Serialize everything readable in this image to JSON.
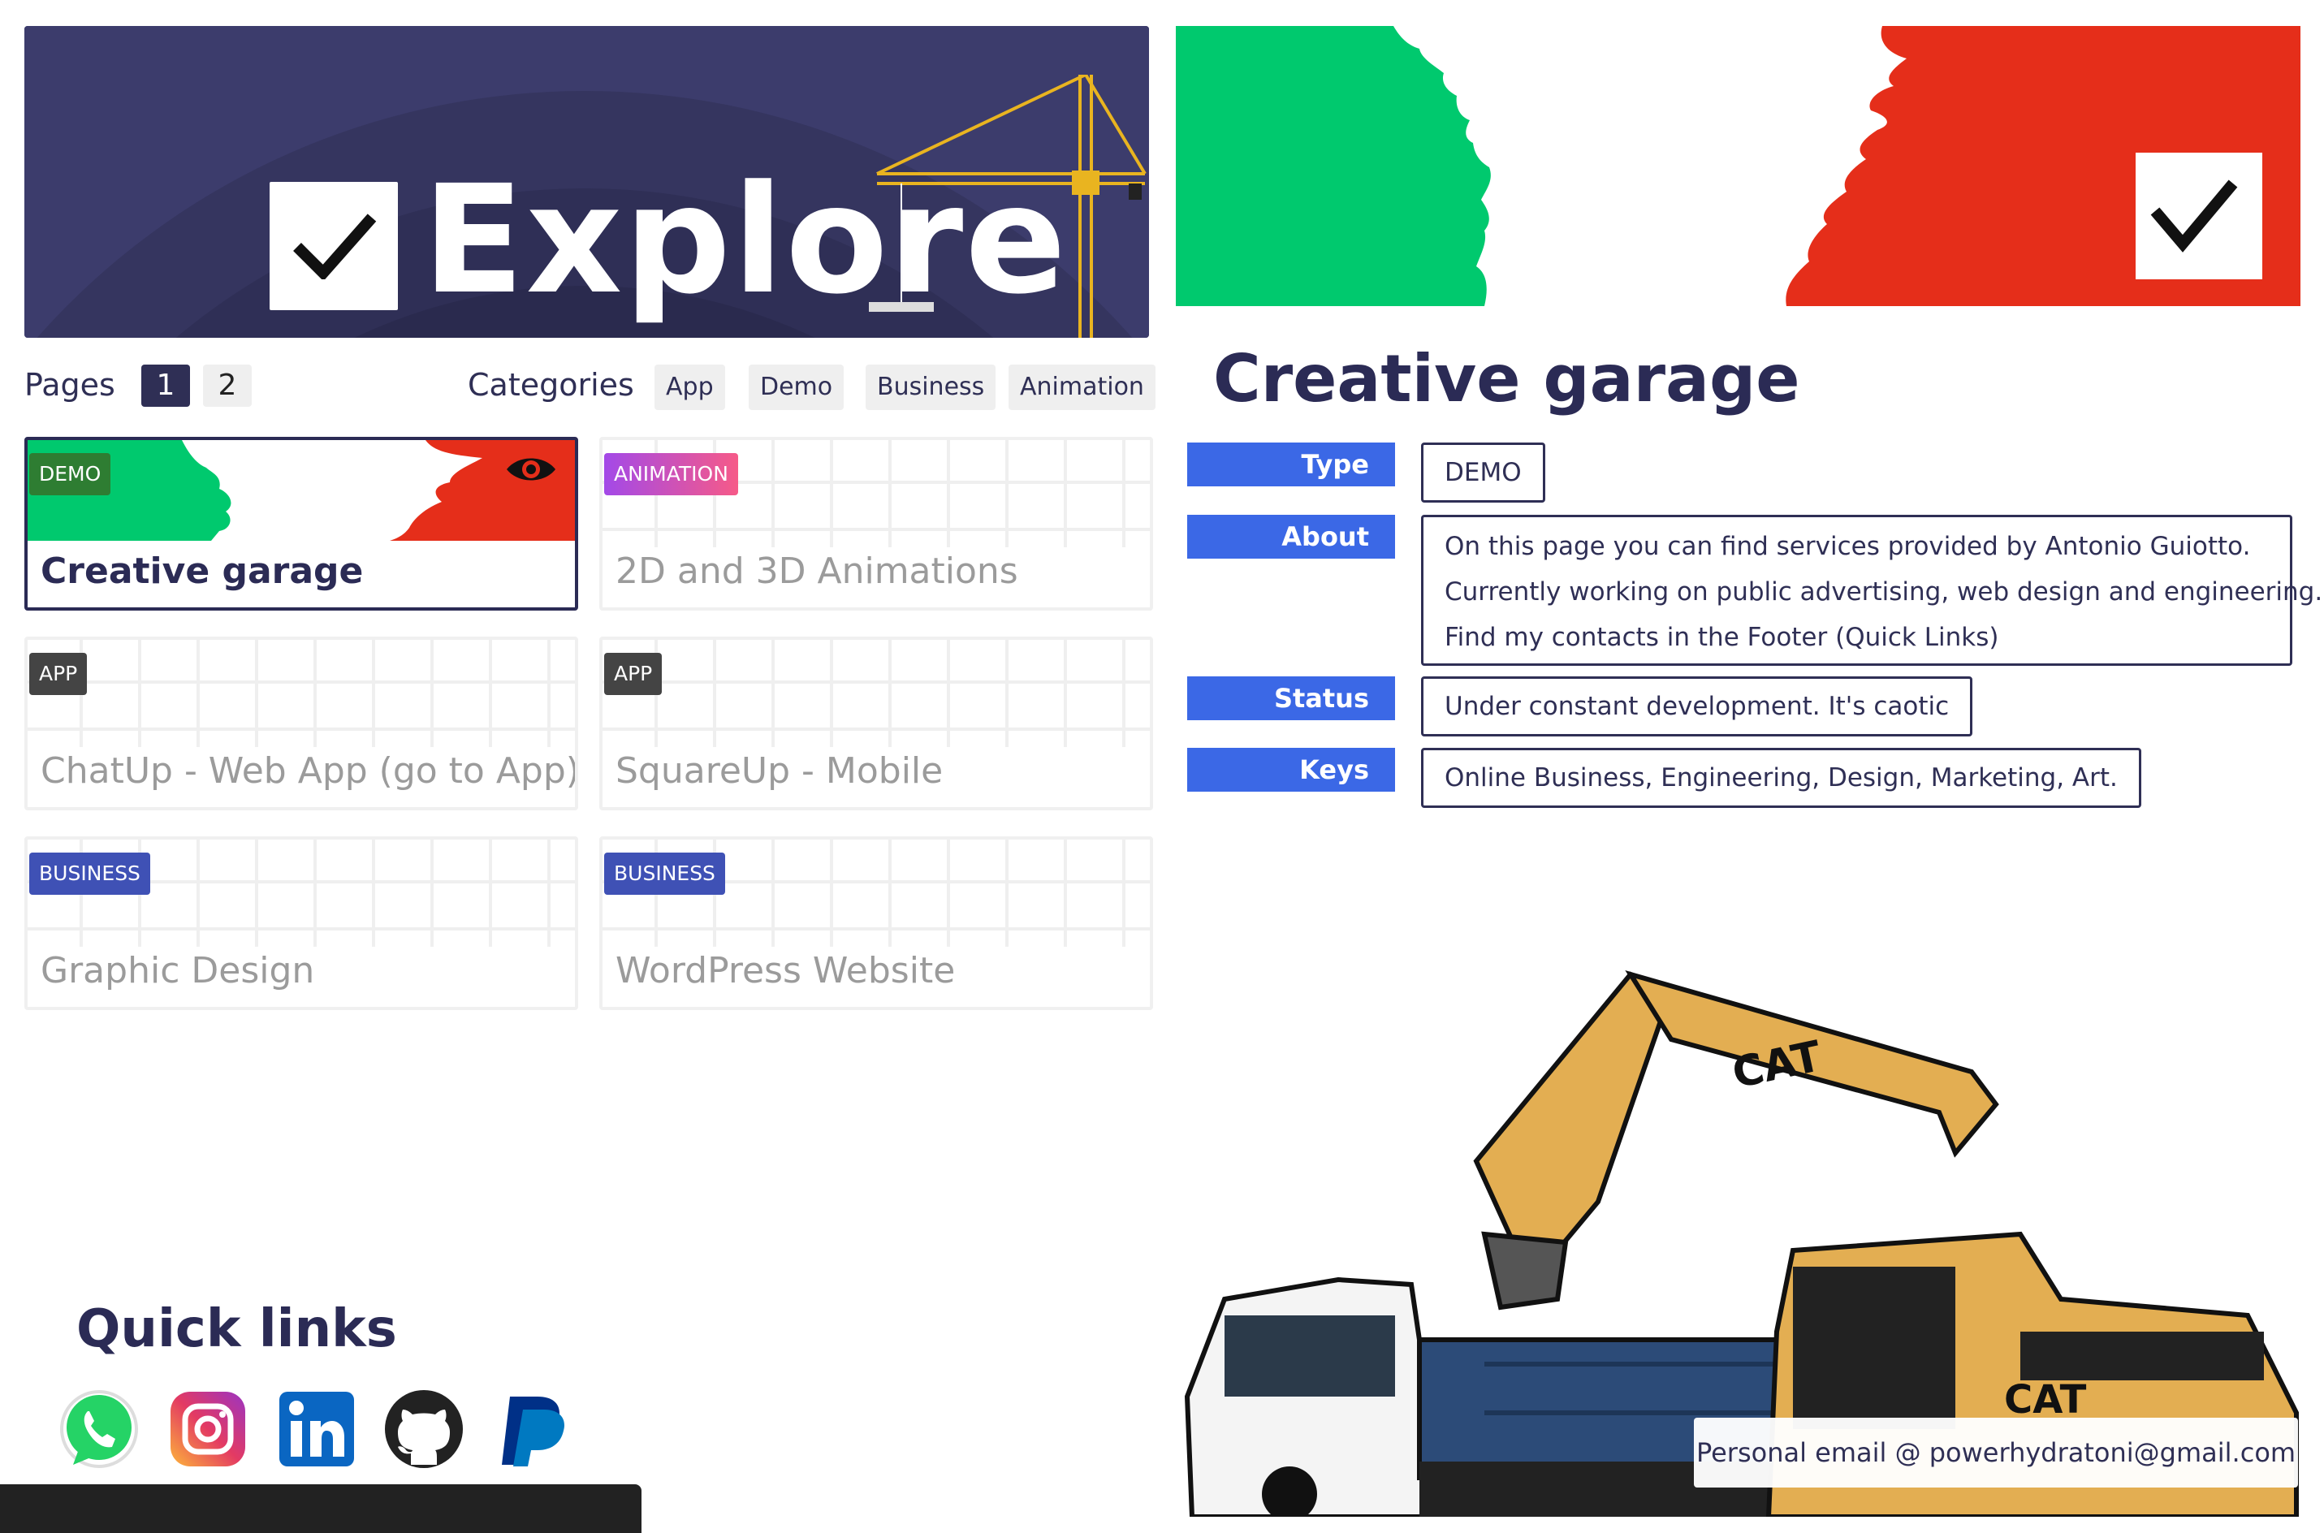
{
  "banner": {
    "title": "Explore"
  },
  "toolbar": {
    "pages_label": "Pages",
    "pages": [
      "1",
      "2"
    ],
    "categories_label": "Categories",
    "categories": [
      "App",
      "Demo",
      "Business",
      "Animation"
    ]
  },
  "cards": [
    {
      "badge": "DEMO",
      "title": "Creative garage"
    },
    {
      "badge": "ANIMATION",
      "title": "2D and 3D Animations"
    },
    {
      "badge": "APP",
      "title": "ChatUp - Web App (go to App)"
    },
    {
      "badge": "APP",
      "title": "SquareUp - Mobile"
    },
    {
      "badge": "BUSINESS",
      "title": "Graphic Design"
    },
    {
      "badge": "BUSINESS",
      "title": "WordPress Website"
    }
  ],
  "detail": {
    "title": "Creative garage",
    "type_label": "Type",
    "type_value": "DEMO",
    "about_label": "About",
    "about_lines": [
      "On this page you can find services provided by Antonio Guiotto.",
      "Currently working on public advertising, web design and engineering.",
      "Find my contacts in the Footer (Quick Links)"
    ],
    "status_label": "Status",
    "status_value": "Under constant development. It's caotic",
    "keys_label": "Keys",
    "keys_value": "Online Business, Engineering, Design, Marketing, Art."
  },
  "footer": {
    "quick_links_title": "Quick links",
    "social_icons": [
      "whatsapp-icon",
      "instagram-icon",
      "linkedin-icon",
      "github-icon",
      "paypal-icon"
    ],
    "email": "Personal email @ powerhydratoni@gmail.com"
  },
  "colors": {
    "navy": "#2b2b55",
    "accent_blue": "#3b68e6",
    "green": "#00c96e",
    "red": "#e52e1a",
    "badge_demo": "#2e7d32",
    "badge_app": "#444444",
    "badge_business": "#3f51b5"
  }
}
